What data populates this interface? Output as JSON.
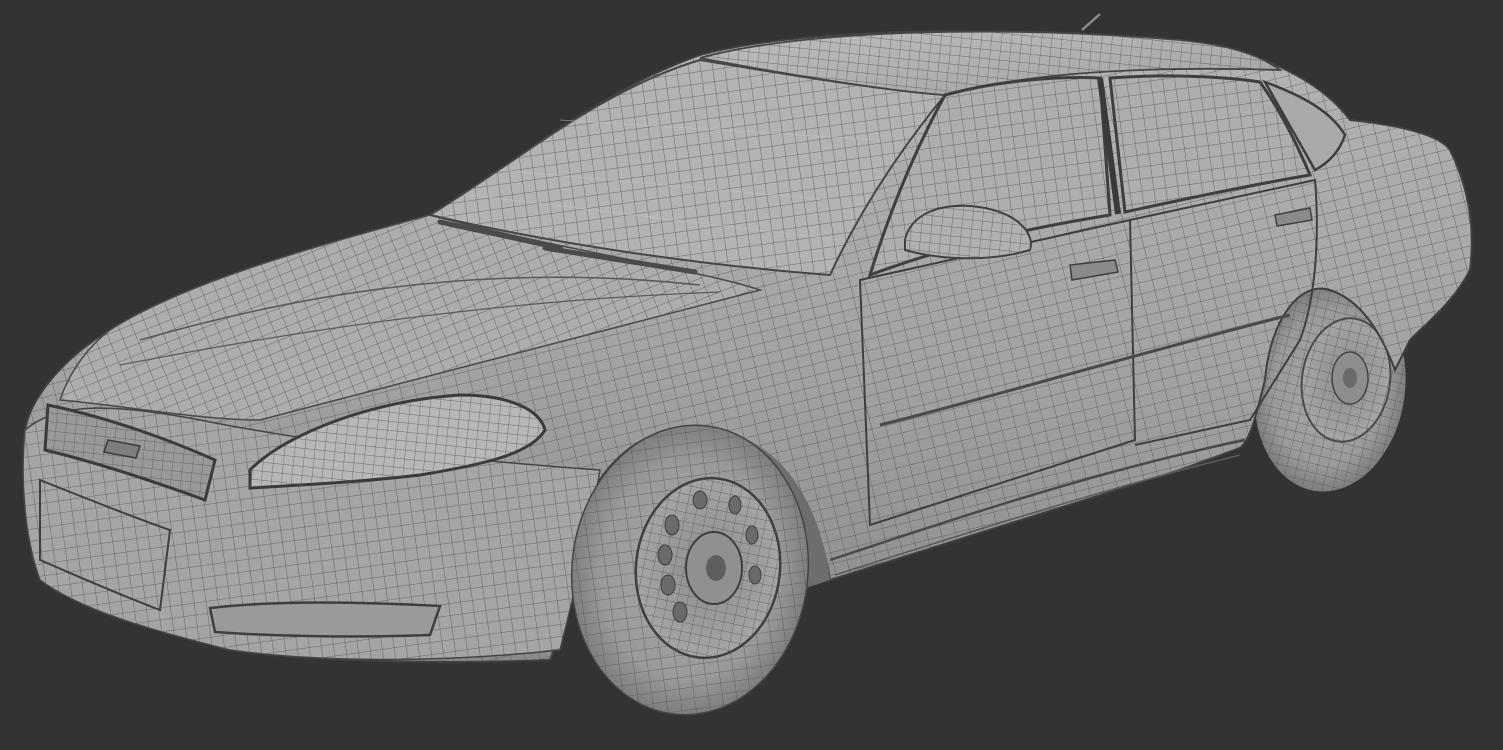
{
  "viewport": {
    "background": "#333333"
  },
  "model": {
    "kind": "sedan",
    "render_mode": "wireframe-on-shaded",
    "surface_color": "#9e9e9e",
    "surface_light": "#b9b9b9",
    "surface_dark": "#7c7c7c",
    "wire_color": "#555555",
    "edge_color": "#3f3f3f",
    "tire_color": "#8d8d8d",
    "glass_color": "#a8a8a8"
  }
}
